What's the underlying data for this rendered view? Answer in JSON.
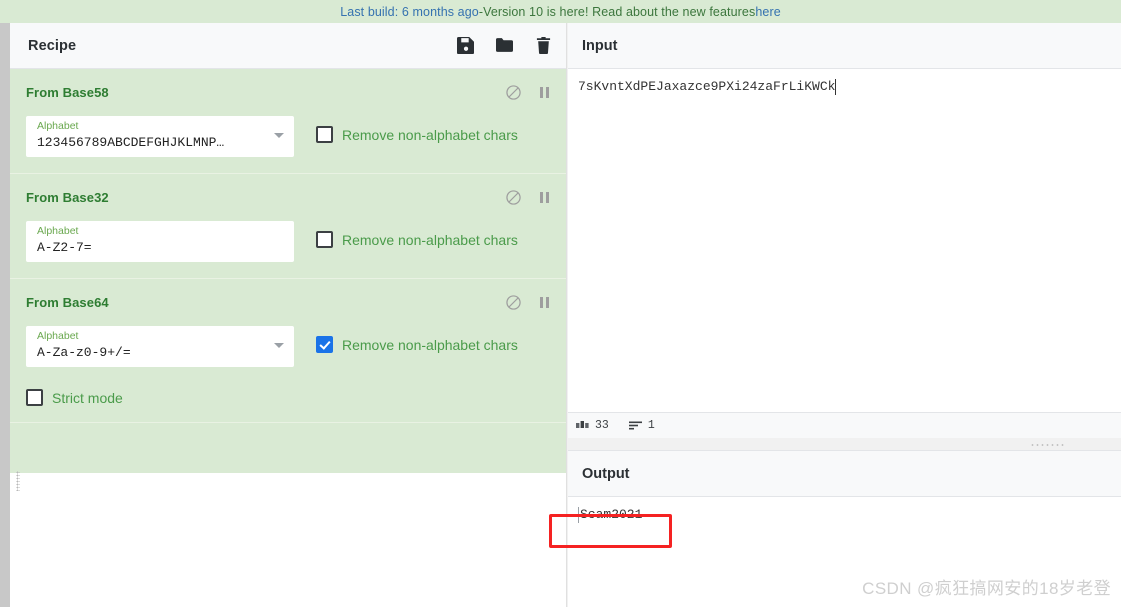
{
  "banner": {
    "build_link": "Last build: 6 months ago",
    "separator": " - ",
    "message": "Version 10 is here! Read about the new features ",
    "more_link": "here"
  },
  "recipe": {
    "title": "Recipe",
    "header_icons": [
      {
        "name": "save-icon",
        "label": "Save recipe"
      },
      {
        "name": "folder-icon",
        "label": "Load recipe"
      },
      {
        "name": "trash-icon",
        "label": "Clear recipe"
      }
    ],
    "operations": [
      {
        "title": "From Base58",
        "field_label": "Alphabet",
        "field_value": "123456789ABCDEFGHJKLMNP…",
        "has_dropdown": true,
        "checkbox_label": "Remove non-alphabet chars",
        "checked": false,
        "disable_icon": "ban-icon",
        "pause_icon": "pause-icon"
      },
      {
        "title": "From Base32",
        "field_label": "Alphabet",
        "field_value": "A-Z2-7=",
        "has_dropdown": false,
        "checkbox_label": "Remove non-alphabet chars",
        "checked": false,
        "disable_icon": "ban-icon",
        "pause_icon": "pause-icon"
      },
      {
        "title": "From Base64",
        "field_label": "Alphabet",
        "field_value": "A-Za-z0-9+/=",
        "has_dropdown": true,
        "checkbox_label": "Remove non-alphabet chars",
        "checked": true,
        "extra_checkbox_label": "Strict mode",
        "extra_checked": false,
        "disable_icon": "ban-icon",
        "pause_icon": "pause-icon"
      }
    ]
  },
  "input": {
    "title": "Input",
    "value": "7sKvntXdPEJaxazce9PXi24zaFrLiKWCk",
    "status": {
      "length_icon": "abc-icon",
      "length": "33",
      "lines_icon": "lines-icon",
      "lines": "1"
    }
  },
  "output": {
    "title": "Output",
    "value": "Scam2021"
  },
  "annotation": {
    "color": "#f52222"
  },
  "watermark": {
    "text": "CSDN @疯狂搞网安的18岁老登"
  }
}
